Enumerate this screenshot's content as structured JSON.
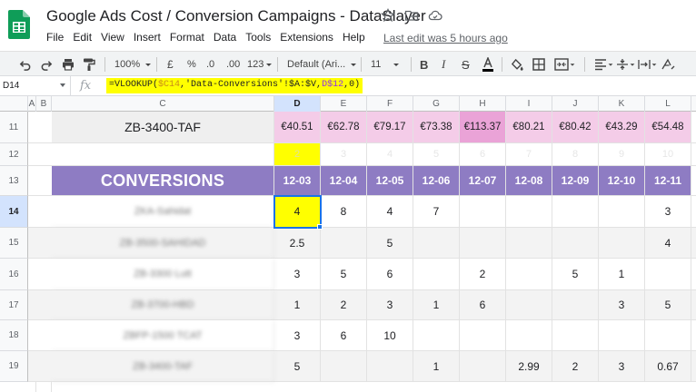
{
  "window": {
    "title": "Google Ads Cost / Conversion Campaigns - DataSlayer",
    "last_edit": "Last edit was 5 hours ago"
  },
  "menu": [
    "File",
    "Edit",
    "View",
    "Insert",
    "Format",
    "Data",
    "Tools",
    "Extensions",
    "Help"
  ],
  "toolbar": {
    "zoom": "100%",
    "currency": "£",
    "percent": "%",
    "decrease_decimals": ".0",
    "increase_decimals": ".00",
    "more_formats": "123",
    "font": "Default (Ari...",
    "font_size": "11"
  },
  "formula_bar": {
    "name_box": "D14",
    "fx": "fx",
    "formula_prefix": "=VLOOKUP(",
    "formula_ref1": "$C14",
    "formula_mid": ",'Data-Conversions'!$A:$V,",
    "formula_ref2": "D$12",
    "formula_suffix": ",0)"
  },
  "columns": [
    "A",
    "B",
    "C",
    "D",
    "E",
    "F",
    "G",
    "H",
    "I",
    "J",
    "K",
    "L"
  ],
  "selected_column": "D",
  "selected_row": "14",
  "rows": {
    "r11": {
      "num": "11",
      "label": "ZB-3400-TAF",
      "values": [
        "€40.51",
        "€62.78",
        "€79.17",
        "€73.38",
        "€113.37",
        "€80.21",
        "€80.42",
        "€43.29",
        "€54.48"
      ]
    },
    "r12": {
      "num": "12",
      "values": [
        "2",
        "3",
        "4",
        "5",
        "6",
        "7",
        "8",
        "9",
        "10"
      ]
    },
    "r13": {
      "num": "13",
      "label": "CONVERSIONS",
      "values": [
        "12-03",
        "12-04",
        "12-05",
        "12-06",
        "12-07",
        "12-08",
        "12-09",
        "12-10",
        "12-11"
      ]
    },
    "r14": {
      "num": "14",
      "label": "ZKA-Sahidat",
      "values": [
        "4",
        "8",
        "4",
        "7",
        "",
        "",
        "",
        "",
        "3"
      ]
    },
    "r15": {
      "num": "15",
      "label": "ZB-3500-SAHIDAD",
      "values": [
        "2.5",
        "",
        "5",
        "",
        "",
        "",
        "",
        "",
        "4"
      ]
    },
    "r16": {
      "num": "16",
      "label": "ZB-3300 Lutt",
      "values": [
        "3",
        "5",
        "6",
        "",
        "2",
        "",
        "5",
        "1",
        ""
      ]
    },
    "r17": {
      "num": "17",
      "label": "ZB-3700-HBD",
      "values": [
        "1",
        "2",
        "3",
        "1",
        "6",
        "",
        "",
        "3",
        "5"
      ]
    },
    "r18": {
      "num": "18",
      "label": "ZBFP-1500 TCAT",
      "values": [
        "3",
        "6",
        "10",
        "",
        "",
        "",
        "",
        "",
        ""
      ]
    },
    "r19": {
      "num": "19",
      "label": "ZB-3400-TAF",
      "values": [
        "5",
        "",
        "",
        "1",
        "",
        "2.99",
        "2",
        "3",
        "0.67"
      ]
    }
  },
  "colors": {
    "header_purple": "#8e7cc3",
    "cost_pink": "#f4cce8",
    "cost_pink_dark": "#eaa3d7",
    "label_grey": "#efefef",
    "stripe_grey": "#f3f3f3",
    "highlight_yellow": "#ffff00",
    "selection_blue": "#1a73e8"
  }
}
